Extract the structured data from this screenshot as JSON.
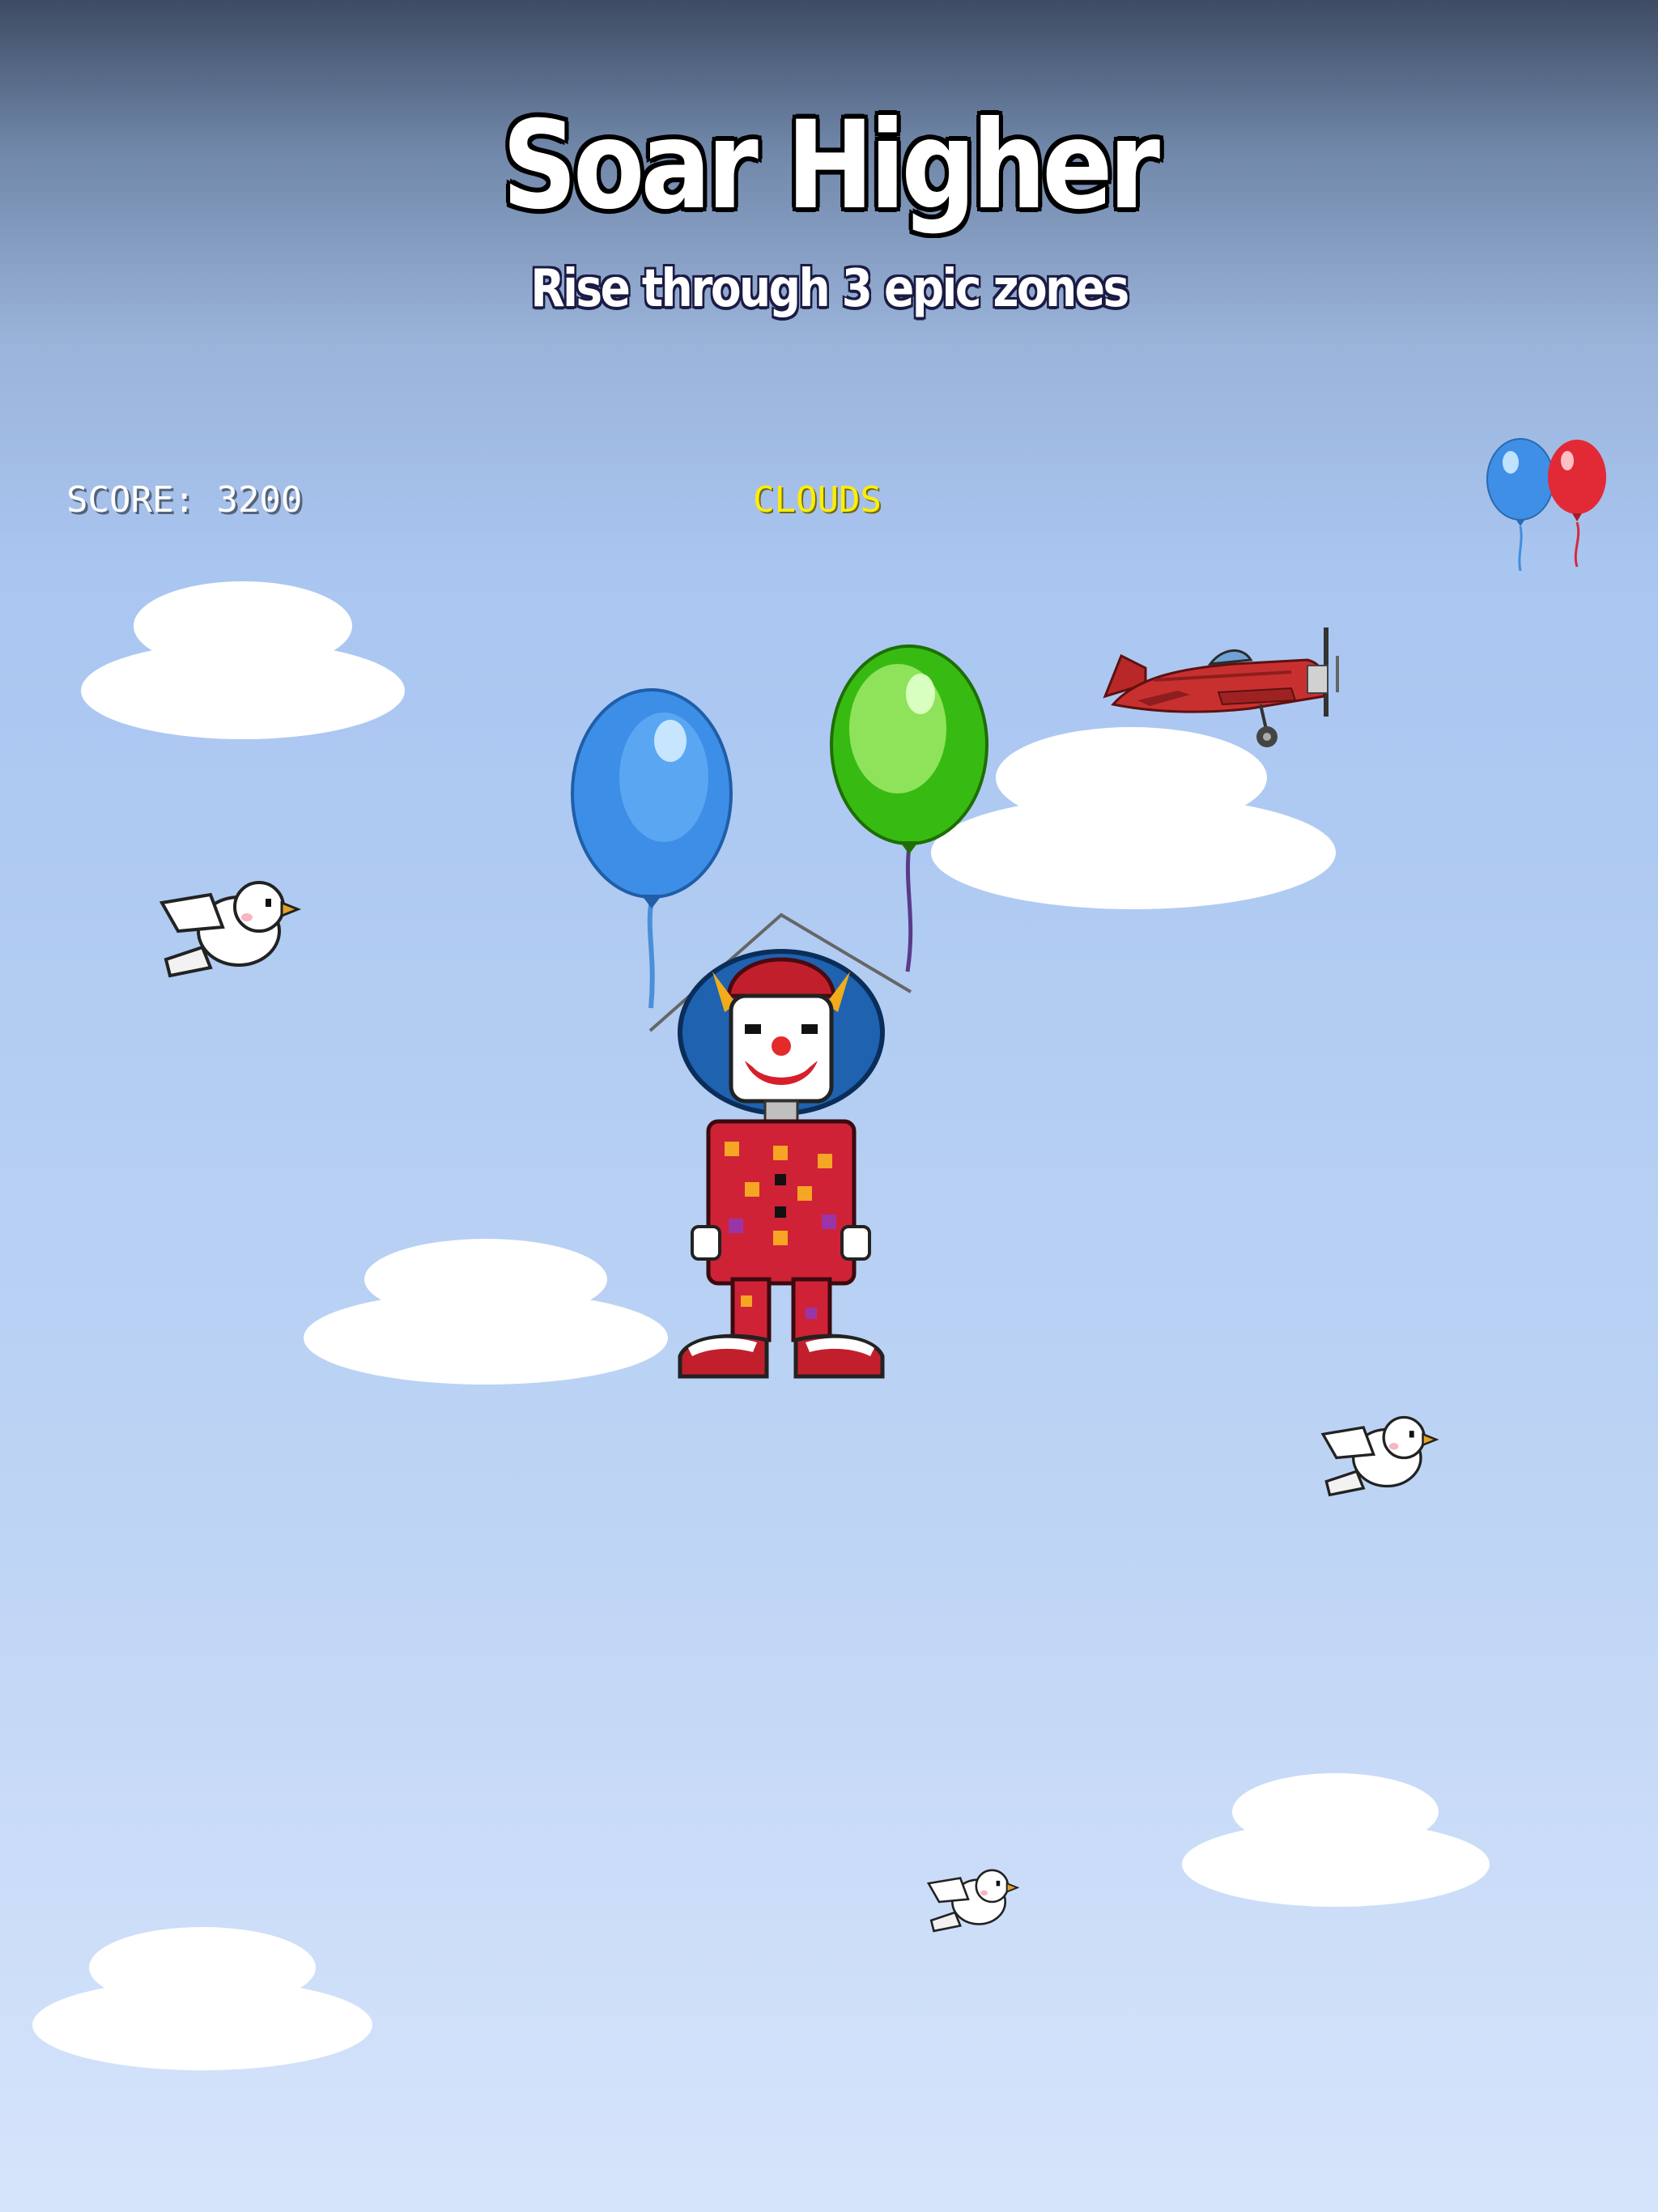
{
  "game": {
    "title": "Soar Higher",
    "subtitle": "Rise through 3 epic zones"
  },
  "hud": {
    "score_label": "SCORE:",
    "score_value": "3200",
    "zone_name": "CLOUDS",
    "lives_balloons": [
      "blue",
      "red"
    ]
  },
  "player": {
    "character": "clown",
    "balloons": [
      "blue",
      "green"
    ]
  },
  "colors": {
    "title": "#ffffff",
    "zone": "#ffee00",
    "sky_top": "#3e4b63",
    "sky_bottom": "#d6e4fb"
  }
}
